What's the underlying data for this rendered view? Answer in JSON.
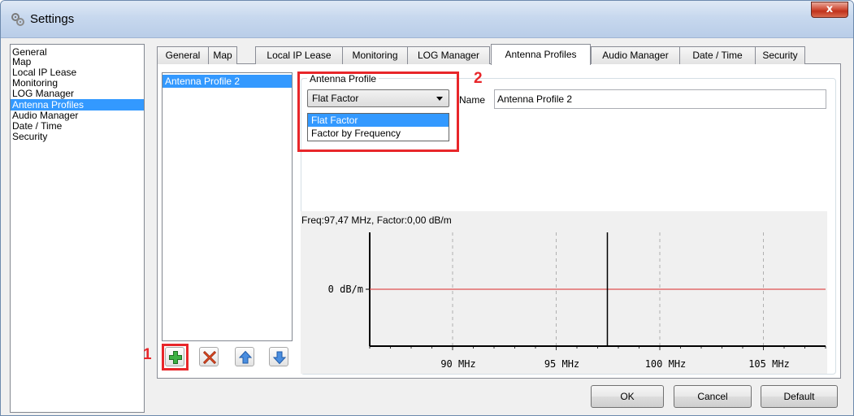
{
  "window": {
    "title": "Settings",
    "close_glyph": "x"
  },
  "sidebar": {
    "items": [
      {
        "label": "General"
      },
      {
        "label": "Map"
      },
      {
        "label": "Local IP Lease"
      },
      {
        "label": "Monitoring"
      },
      {
        "label": "LOG Manager"
      },
      {
        "label": "Antenna Profiles",
        "selected": true
      },
      {
        "label": "Audio Manager"
      },
      {
        "label": "Date / Time"
      },
      {
        "label": "Security"
      }
    ]
  },
  "tabs": [
    {
      "label": "General"
    },
    {
      "label": "Map"
    },
    {
      "label": "Local IP Lease"
    },
    {
      "label": "Monitoring"
    },
    {
      "label": "LOG Manager"
    },
    {
      "label": "Antenna Profiles",
      "active": true
    },
    {
      "label": "Audio Manager"
    },
    {
      "label": "Date / Time"
    },
    {
      "label": "Security"
    }
  ],
  "profiles": {
    "items": [
      "Antenna Profile 2"
    ]
  },
  "profile_group": {
    "label": "Antenna Profile",
    "type_selected": "Flat Factor",
    "type_options": [
      "Flat Factor",
      "Factor by Frequency"
    ],
    "name_label": "Name",
    "name_value": "Antenna Profile 2"
  },
  "chart": {
    "readout": "Freq:97,47 MHz, Factor:0,00 dB/m",
    "y_label": "0 dB/m",
    "x_ticks": [
      "90 MHz",
      "95 MHz",
      "100 MHz",
      "105 MHz"
    ]
  },
  "chart_data": {
    "type": "line",
    "x": [
      86,
      108
    ],
    "series": [
      {
        "values": [
          0,
          0
        ]
      }
    ],
    "x_ticks": [
      90,
      95,
      100,
      105
    ],
    "tick_labels": [
      "90 MHz",
      "95 MHz",
      "100 MHz",
      "105 MHz"
    ],
    "y_tick_label": "0 dB/m",
    "cursor_x": 97.47,
    "line_color": "#e05050",
    "grid": true
  },
  "annotations": {
    "marker_1": "1",
    "marker_2": "2",
    "color": "#e8262a"
  },
  "toolbar": {
    "add_icon": "add-icon",
    "delete_icon": "delete-icon",
    "up_icon": "arrow-up-icon",
    "down_icon": "arrow-down-icon"
  },
  "buttons": {
    "ok": "OK",
    "cancel": "Cancel",
    "default": "Default"
  },
  "colors": {
    "selection": "#3399ff",
    "titlebar": "#c7d8ee",
    "close": "#c0321c"
  }
}
